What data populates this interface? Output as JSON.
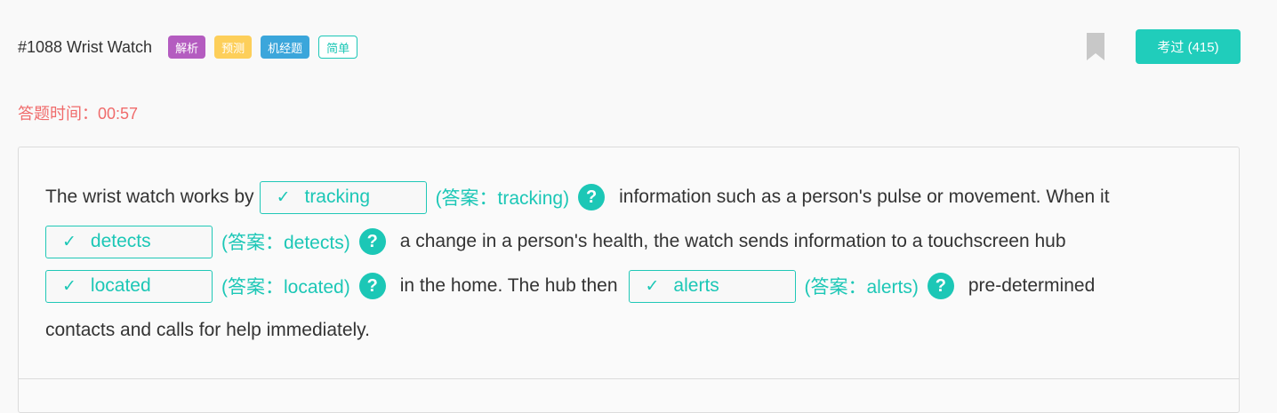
{
  "header": {
    "title": "#1088 Wrist Watch",
    "tags": [
      "解析",
      "预测",
      "机经题",
      "简单"
    ],
    "pass_button": "考过 (415)"
  },
  "timer": {
    "label": "答题时间：00:57"
  },
  "colors": {
    "accent": "#1cc7b6",
    "timer": "#f06b6b",
    "tag_purple": "#b45cc0",
    "tag_yellow": "#fdcf5a",
    "tag_blue": "#3ba6db"
  },
  "question": {
    "seg1": "The wrist watch works by",
    "blank1": {
      "value": "tracking",
      "answer": "(答案：tracking)"
    },
    "seg2": "information such as a person's pulse or movement. When it",
    "blank2": {
      "value": "detects",
      "answer": "(答案：detects)"
    },
    "seg3": "a change in a person's health, the watch sends information to a touchscreen hub",
    "blank3": {
      "value": "located",
      "answer": "(答案：located)"
    },
    "seg4": "in the home. The hub then",
    "blank4": {
      "value": "alerts",
      "answer": "(答案：alerts)"
    },
    "seg5": "pre-determined",
    "seg6": "contacts and calls for help immediately."
  },
  "icons": {
    "check": "✓",
    "help": "?",
    "bookmark": "bookmark-icon"
  }
}
